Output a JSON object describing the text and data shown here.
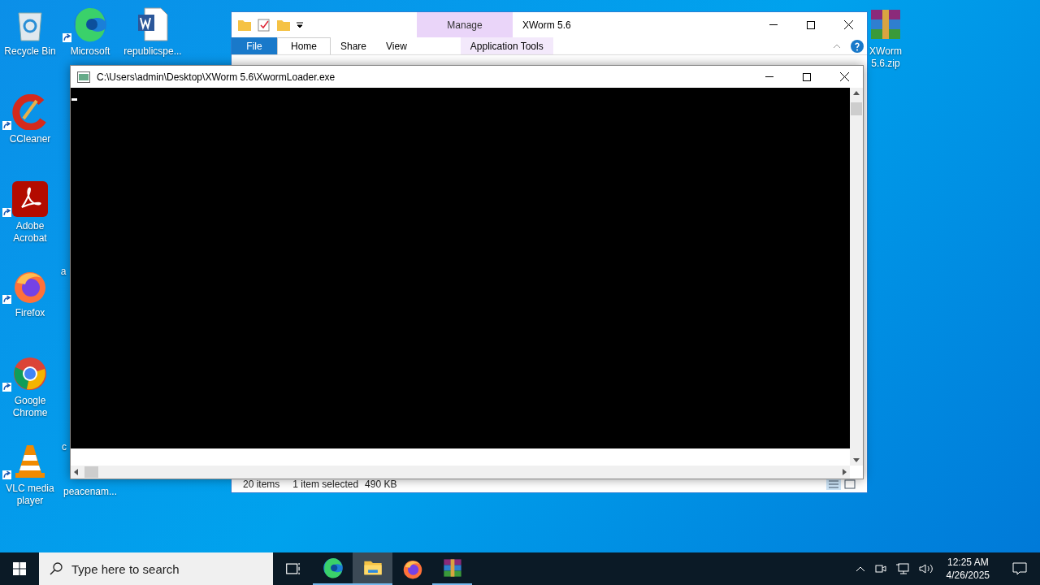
{
  "desktop_icons": [
    {
      "label": "Recycle Bin",
      "kind": "recycle",
      "shortcut": false
    },
    {
      "label": "Microsoft",
      "kind": "edge",
      "shortcut": true
    },
    {
      "label": "republicspe...",
      "kind": "word",
      "shortcut": false
    },
    {
      "label": "CCleaner",
      "kind": "ccleaner",
      "shortcut": true
    },
    {
      "label": "Adobe Acrobat",
      "kind": "acrobat",
      "shortcut": true
    },
    {
      "label": "a",
      "kind": "covered",
      "shortcut": false
    },
    {
      "label": "Firefox",
      "kind": "firefox",
      "shortcut": true
    },
    {
      "label": "Google Chrome",
      "kind": "chrome",
      "shortcut": true
    },
    {
      "label": "c",
      "kind": "covered",
      "shortcut": false
    },
    {
      "label": "VLC media player",
      "kind": "vlc",
      "shortcut": true
    },
    {
      "label": "peacenam...",
      "kind": "covered",
      "shortcut": false
    },
    {
      "label": "XWorm 5.6.zip",
      "kind": "winrar",
      "shortcut": false
    }
  ],
  "explorer": {
    "title": "XWorm 5.6",
    "context_group": "Manage",
    "tabs": [
      {
        "label": "File",
        "kind": "file",
        "selected": false
      },
      {
        "label": "Home",
        "kind": "tab",
        "selected": true
      },
      {
        "label": "Share",
        "kind": "tab",
        "selected": false
      },
      {
        "label": "View",
        "kind": "tab",
        "selected": false
      },
      {
        "label": "Application Tools",
        "kind": "context",
        "selected": false
      }
    ],
    "status_bar": {
      "items": "20 items",
      "selection": "1 item selected",
      "size": "490 KB"
    }
  },
  "console": {
    "title": "C:\\Users\\admin\\Desktop\\XWorm 5.6\\XwormLoader.exe"
  },
  "taskbar": {
    "search": {
      "placeholder": "Type here to search"
    },
    "apps": [
      {
        "kind": "taskview",
        "running": false,
        "selected": false
      },
      {
        "kind": "edge",
        "running": true,
        "selected": false
      },
      {
        "kind": "explorer",
        "running": true,
        "selected": true
      },
      {
        "kind": "firefox",
        "running": false,
        "selected": false
      },
      {
        "kind": "winrar",
        "running": true,
        "selected": false
      }
    ],
    "time": "12:25 AM",
    "date": "4/26/2025"
  }
}
